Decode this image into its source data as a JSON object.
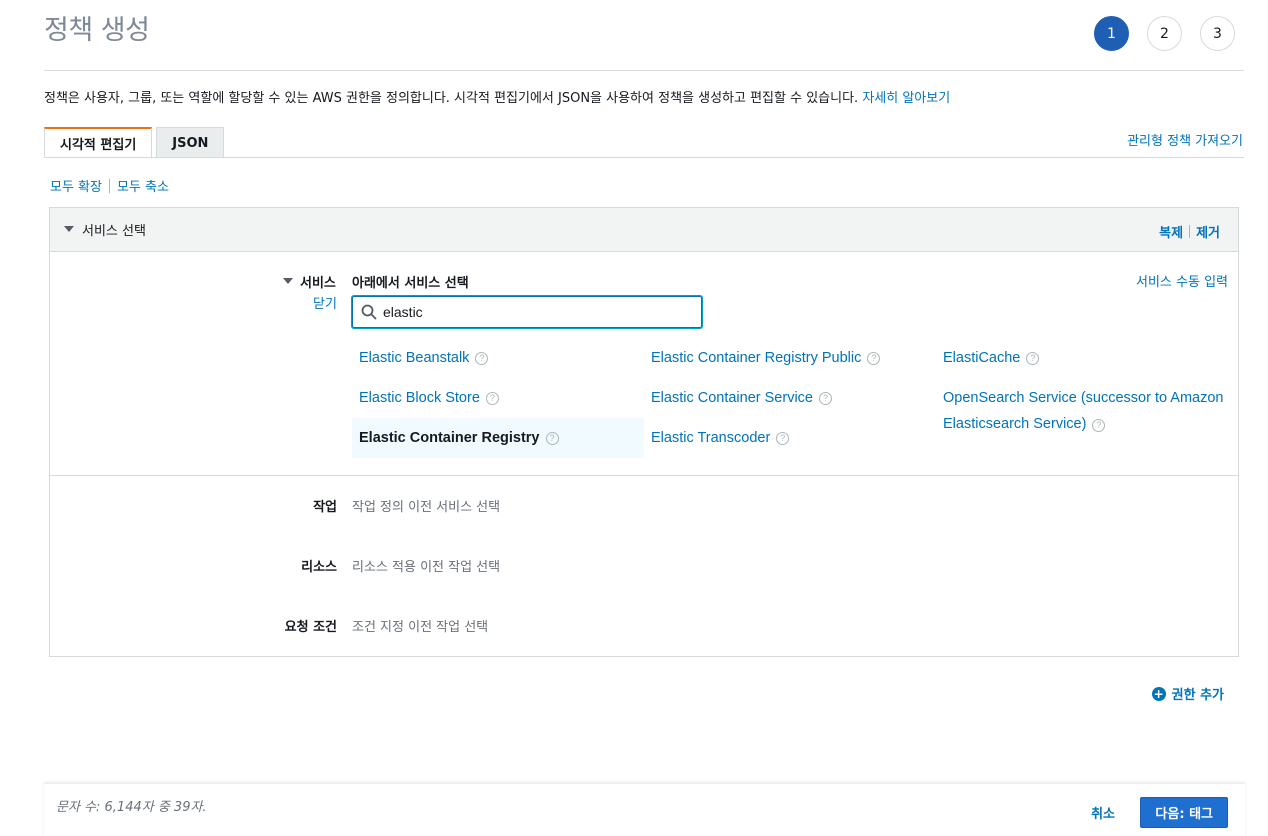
{
  "page": {
    "title": "정책 생성",
    "steps": [
      "1",
      "2",
      "3"
    ],
    "description": "정책은 사용자, 그룹, 또는 역할에 할당할 수 있는 AWS 권한을 정의합니다. 시각적 편집기에서 JSON을 사용하여 정책을 생성하고 편집할 수 있습니다.",
    "learn_more": "자세히 알아보기"
  },
  "tabs": {
    "visual": "시각적 편집기",
    "json": "JSON",
    "import_link": "관리형 정책 가져오기"
  },
  "toolbar": {
    "expand_all": "모두 확장",
    "collapse_all": "모두 축소"
  },
  "panel": {
    "title": "서비스 선택",
    "duplicate": "복제",
    "remove": "제거",
    "service_label": "서비스",
    "close": "닫기",
    "choose_below": "아래에서 서비스 선택",
    "manual_entry": "서비스 수동 입력",
    "search_value": "elastic",
    "services": [
      "Elastic Beanstalk",
      "Elastic Block Store",
      "Elastic Container Registry",
      "Elastic Container Registry Public",
      "Elastic Container Service",
      "Elastic Transcoder",
      "ElastiCache",
      "OpenSearch Service (successor to Amazon Elasticsearch Service)"
    ],
    "rows": [
      {
        "label": "작업",
        "value": "작업 정의 이전 서비스 선택"
      },
      {
        "label": "리소스",
        "value": "리소스 적용 이전 작업 선택"
      },
      {
        "label": "요청 조건",
        "value": "조건 지정 이전 작업 선택"
      }
    ]
  },
  "add_permissions": "권한 추가",
  "footer": {
    "char_count": "문자 수: 6,144자 중 39자.",
    "cancel": "취소",
    "next": "다음: 태그"
  },
  "colors": {
    "accent": "#1e5fb4",
    "link": "#0073bb",
    "tab_active_border": "#ec7211"
  }
}
